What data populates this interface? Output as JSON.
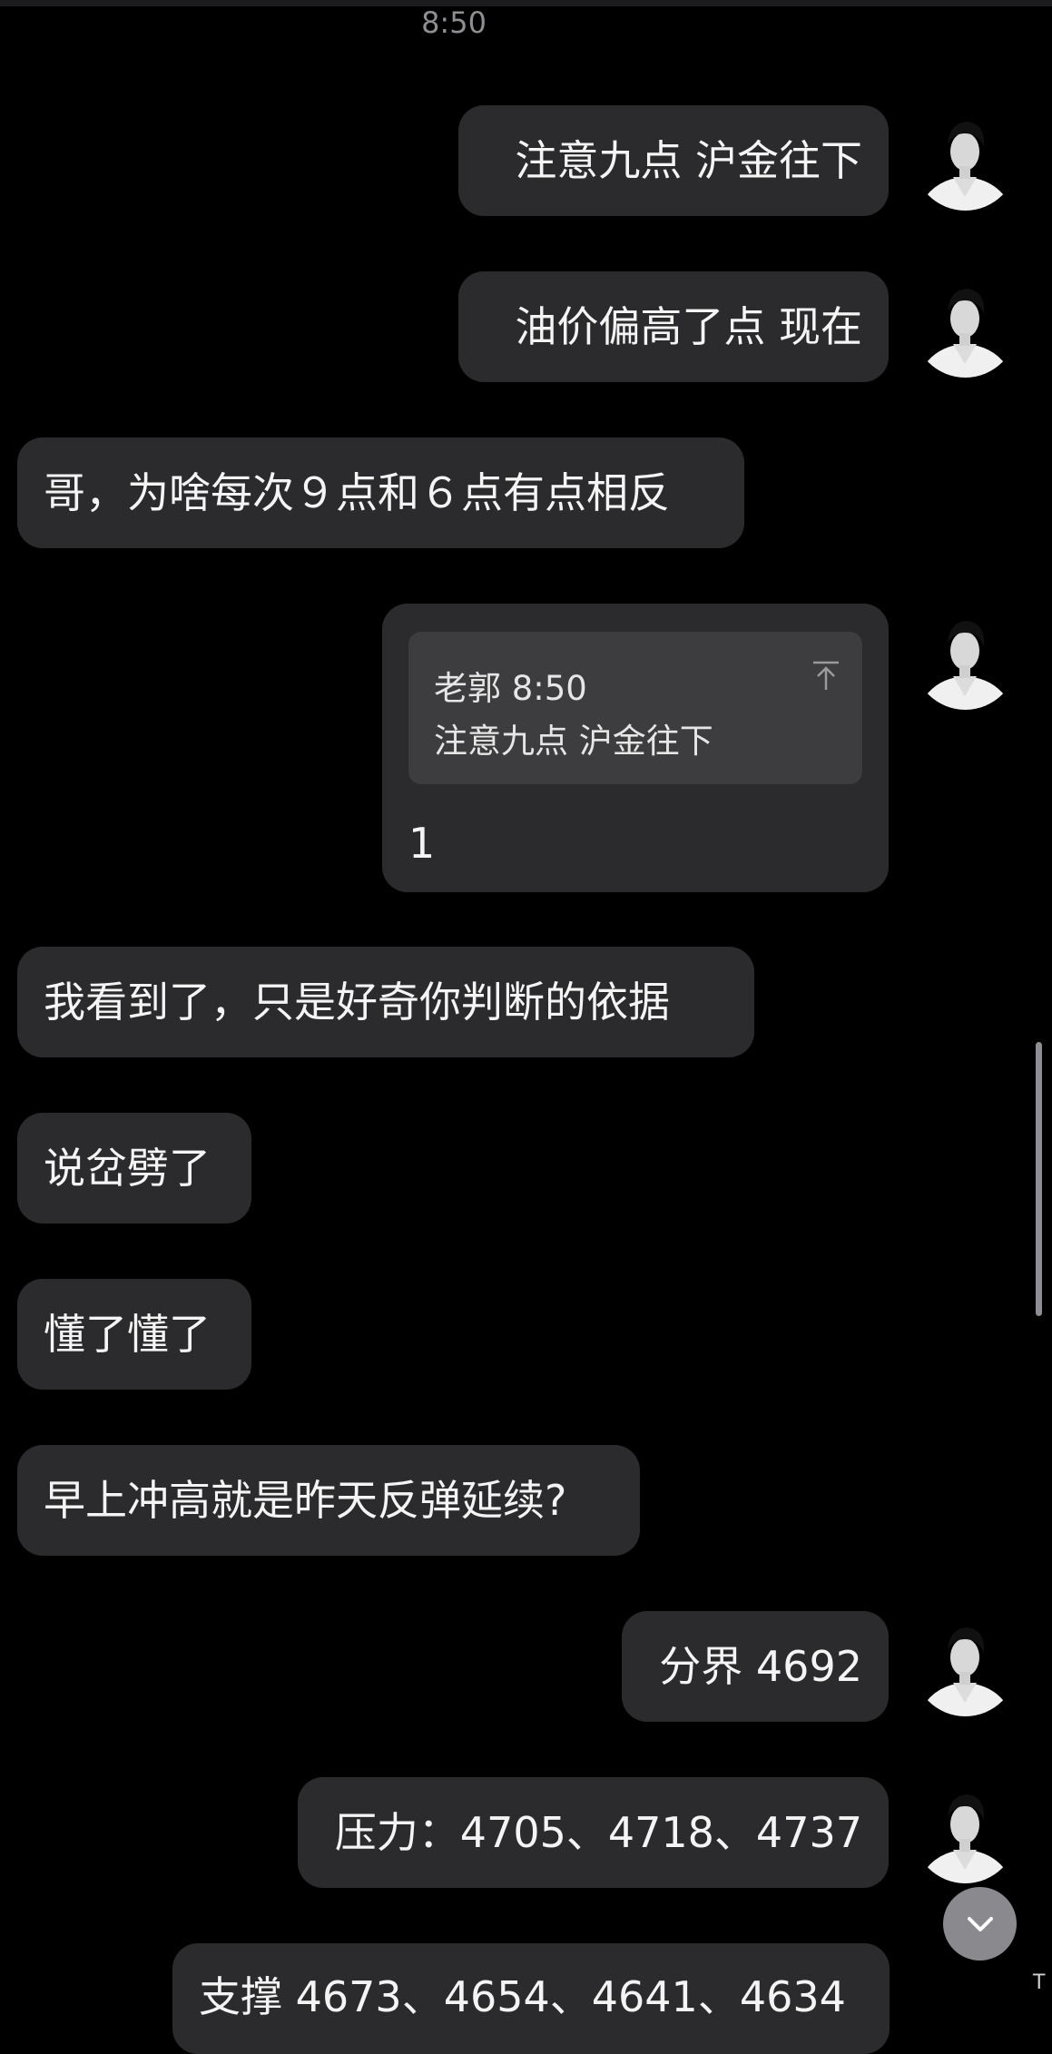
{
  "time_separator": "8:50",
  "messages": [
    {
      "text": "注意九点 沪金往下"
    },
    {
      "text": "油价偏高了点 现在"
    },
    {
      "text": "哥，为啥每次９点和６点有点相反"
    },
    {
      "text": "我看到了，只是好奇你判断的依据"
    },
    {
      "text": "说岔劈了"
    },
    {
      "text": "懂了懂了"
    },
    {
      "text": "早上冲高就是昨天反弹延续?"
    },
    {
      "text": "分界 4692"
    },
    {
      "text": "压力：4705、4718、4737"
    },
    {
      "text": "支撑 4673、4654、4641、4634"
    }
  ],
  "quote": {
    "author_time": "老郭 8:50",
    "text": "注意九点 沪金往下",
    "reply": "1"
  },
  "icons": {
    "scroll_top": "arrow-to-top-icon",
    "scroll_down": "chevron-down-icon"
  },
  "colors": {
    "background": "#000000",
    "bubble": "#2b2b2d",
    "quote_box": "#3d3d3f",
    "time": "#8e8e93"
  }
}
